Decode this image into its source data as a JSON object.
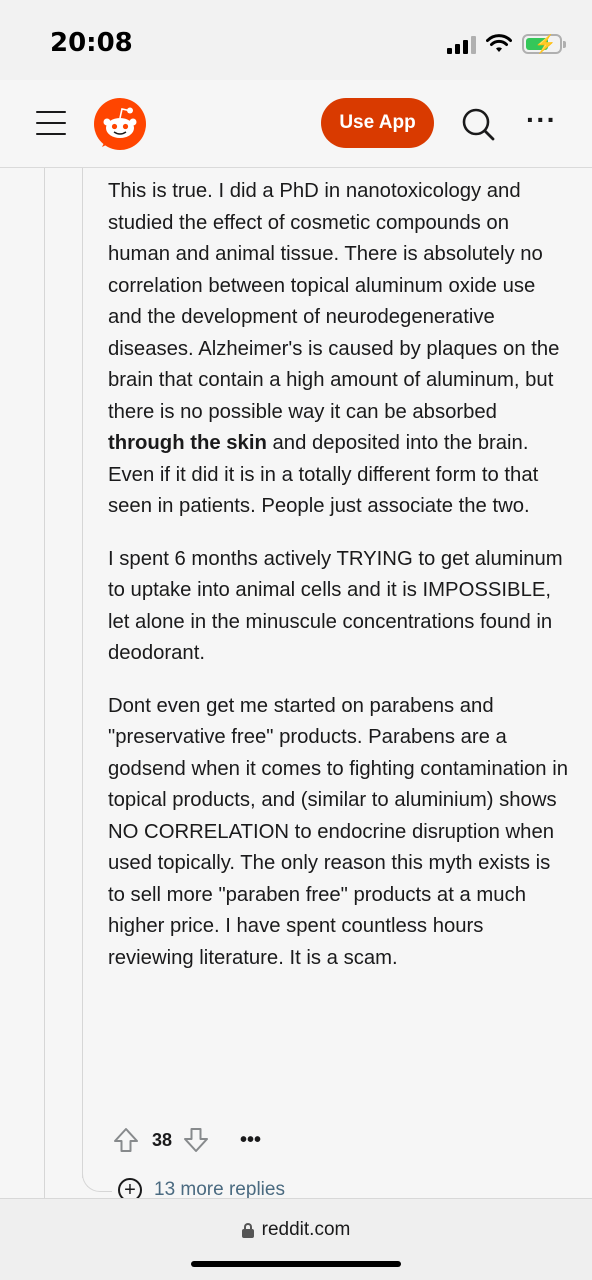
{
  "status": {
    "time": "20:08"
  },
  "header": {
    "use_app_label": "Use App"
  },
  "comment": {
    "p1_a": "This is true. I did a PhD in nanotoxicology and studied the effect of cosmetic compounds on human and animal tissue. There is absolutely no correlation between topical aluminum oxide use and the development of neurodegenerative diseases. Alzheimer's is caused by plaques on the brain that contain a high amount of aluminum, but there is no possible way it can be absorbed ",
    "p1_bold": "through the skin",
    "p1_b": " and deposited into the brain. Even if it did it is in a totally different form to that seen in patients. People just associate the two.",
    "p2": "I spent 6 months actively TRYING to get aluminum to uptake into animal cells and it is IMPOSSIBLE, let alone in the minuscule concentrations found in deodorant.",
    "p3": "Dont even get me started on parabens and \"preservative free\" products. Parabens are a godsend when it comes to fighting contamination in topical products, and (similar to aluminium) shows NO CORRELATION to endocrine disruption when used topically. The only reason this myth exists is to sell more \"paraben free\" products at a much higher price. I have spent countless hours reviewing literature. It is a scam.",
    "score": "38",
    "more_label": "•••"
  },
  "more_replies": {
    "label": "13 more replies"
  },
  "browser": {
    "url": "reddit.com"
  },
  "colors": {
    "brand": "#ff4500",
    "use_app_bg": "#d93a00",
    "link": "#4a6a80"
  },
  "icons": [
    "menu-icon",
    "reddit-logo-icon",
    "search-icon",
    "more-icon",
    "upvote-icon",
    "downvote-icon",
    "plus-circle-icon",
    "lock-icon",
    "signal-icon",
    "wifi-icon",
    "battery-icon"
  ]
}
